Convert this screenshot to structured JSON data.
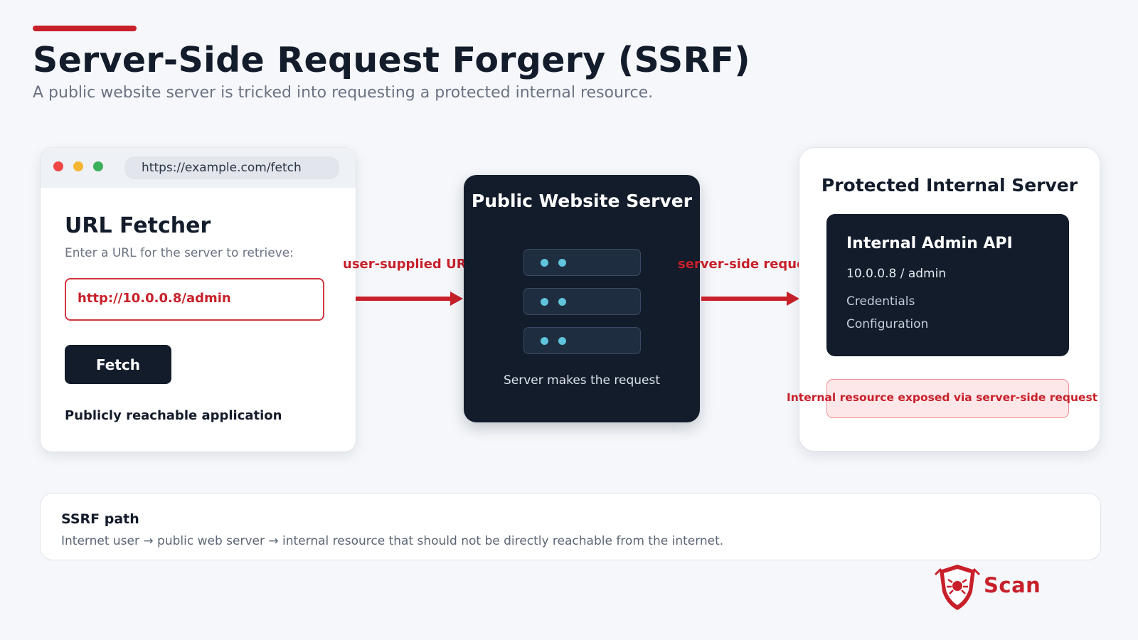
{
  "header": {
    "title": "Server-Side Request Forgery (SSRF)",
    "subtitle": "A public website server is tricked into requesting a protected internal resource."
  },
  "browser": {
    "url": "https://example.com/fetch",
    "title": "URL Fetcher",
    "hint": "Enter a URL for the server to retrieve:",
    "input_value": "http://10.0.0.8/admin",
    "button_label": "Fetch",
    "note": "Publicly reachable application"
  },
  "server": {
    "title": "Public Website Server",
    "caption": "Server makes the request"
  },
  "arrows": {
    "user_label": "user-supplied URL",
    "server_label": "server-side request"
  },
  "internal": {
    "title": "Protected Internal Server",
    "api_title": "Internal Admin API",
    "address": "10.0.0.8 / admin",
    "items": [
      "Credentials",
      "Configuration"
    ],
    "exposed": "Internal resource exposed via server-side request"
  },
  "path": {
    "title": "SSRF path",
    "text": "Internet user → public web server → internal resource that should not be directly reachable from the internet."
  },
  "logo": {
    "text": "Scan"
  },
  "colors": {
    "accent": "#c8202a",
    "dark": "#131c2b",
    "background": "#f5f7fa"
  }
}
